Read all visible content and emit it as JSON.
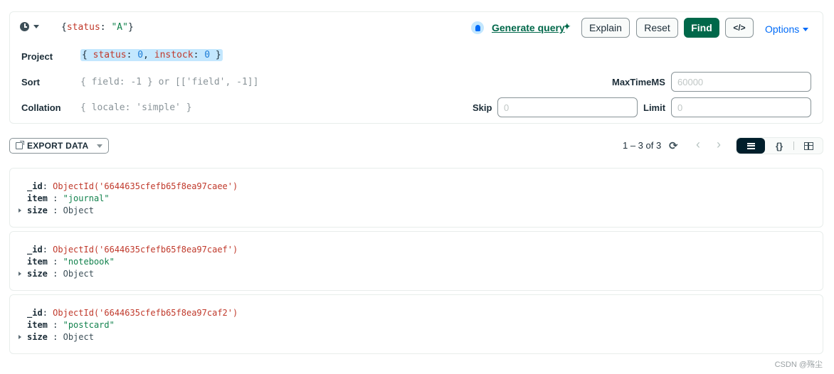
{
  "query_bar": {
    "filter": {
      "open": "{",
      "key": "status",
      "colon": ": ",
      "value": "\"A\"",
      "close": "}"
    },
    "generate_query_label": "Generate query",
    "sparkle_glyph": "✦",
    "buttons": {
      "explain": "Explain",
      "reset": "Reset",
      "find": "Find",
      "code": "</>"
    },
    "options_label": "Options",
    "project": {
      "label": "Project",
      "tokens": [
        {
          "text": "{ ",
          "kind": "plain"
        },
        {
          "text": "status",
          "kind": "key"
        },
        {
          "text": ": ",
          "kind": "plain"
        },
        {
          "text": "0",
          "kind": "num"
        },
        {
          "text": ", ",
          "kind": "plain"
        },
        {
          "text": "instock",
          "kind": "key"
        },
        {
          "text": ": ",
          "kind": "plain"
        },
        {
          "text": "0",
          "kind": "num"
        },
        {
          "text": " }",
          "kind": "plain"
        }
      ]
    },
    "sort": {
      "label": "Sort",
      "placeholder": "{ field: -1 } or [['field', -1]]"
    },
    "collation": {
      "label": "Collation",
      "placeholder": "{ locale: 'simple' }"
    },
    "max_time_ms": {
      "label": "MaxTimeMS",
      "placeholder": "60000",
      "value": ""
    },
    "skip": {
      "label": "Skip",
      "placeholder": "0",
      "value": ""
    },
    "limit": {
      "label": "Limit",
      "placeholder": "0",
      "value": ""
    }
  },
  "toolbar": {
    "export_label": "EXPORT DATA",
    "page_count": "1 – 3 of 3",
    "refresh_glyph": "⟳",
    "prev_glyph": "‹",
    "next_glyph": "›",
    "json_view_glyph": "{}",
    "active_view": "list"
  },
  "documents": [
    {
      "id_key": "_id",
      "id_value": "ObjectId('6644635cfefb65f8ea97caee')",
      "item_key": "item",
      "item_value": "\"journal\"",
      "size_key": "size",
      "size_value": "Object"
    },
    {
      "id_key": "_id",
      "id_value": "ObjectId('6644635cfefb65f8ea97caef')",
      "item_key": "item",
      "item_value": "\"notebook\"",
      "size_key": "size",
      "size_value": "Object"
    },
    {
      "id_key": "_id",
      "id_value": "ObjectId('6644635cfefb65f8ea97caf2')",
      "item_key": "item",
      "item_value": "\"postcard\"",
      "size_key": "size",
      "size_value": "Object"
    }
  ],
  "watermark": "CSDN @殇尘",
  "colors": {
    "accent_green": "#00684a",
    "link_blue": "#016bf8",
    "key_red": "#c0392b",
    "string_green": "#12824d",
    "highlight": "#c3e7fe"
  }
}
